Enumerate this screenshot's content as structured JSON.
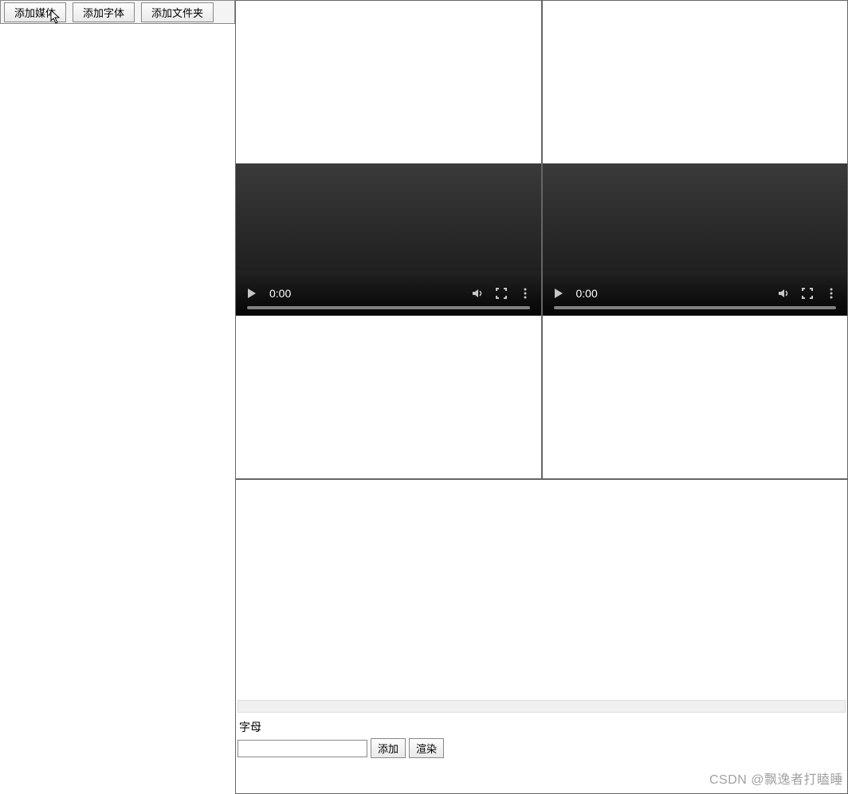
{
  "toolbar": {
    "add_media": "添加媒体",
    "add_font": "添加字体",
    "add_folder": "添加文件夹"
  },
  "video": {
    "left": {
      "time": "0:00"
    },
    "right": {
      "time": "0:00"
    }
  },
  "form": {
    "label": "字母",
    "input_value": "",
    "add_button": "添加",
    "render_button": "渲染"
  },
  "watermark": "CSDN @飘逸者打瞌睡",
  "icons": {
    "play": "play-icon",
    "volume": "volume-icon",
    "fullscreen": "fullscreen-icon",
    "menu": "menu-icon"
  }
}
